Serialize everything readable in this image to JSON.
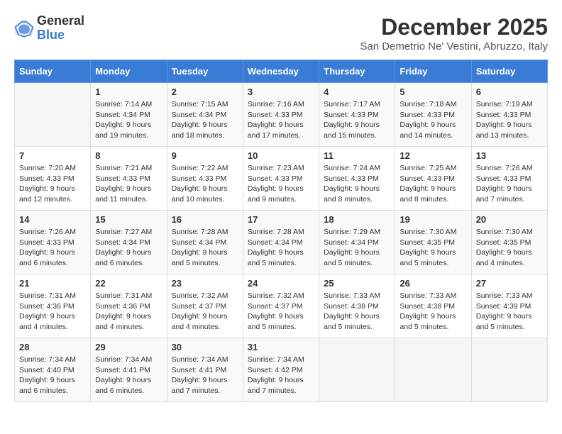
{
  "header": {
    "logo_general": "General",
    "logo_blue": "Blue",
    "month_year": "December 2025",
    "location": "San Demetrio Ne' Vestini, Abruzzo, Italy"
  },
  "days_of_week": [
    "Sunday",
    "Monday",
    "Tuesday",
    "Wednesday",
    "Thursday",
    "Friday",
    "Saturday"
  ],
  "weeks": [
    [
      {
        "day": "",
        "info": ""
      },
      {
        "day": "1",
        "info": "Sunrise: 7:14 AM\nSunset: 4:34 PM\nDaylight: 9 hours\nand 19 minutes."
      },
      {
        "day": "2",
        "info": "Sunrise: 7:15 AM\nSunset: 4:34 PM\nDaylight: 9 hours\nand 18 minutes."
      },
      {
        "day": "3",
        "info": "Sunrise: 7:16 AM\nSunset: 4:33 PM\nDaylight: 9 hours\nand 17 minutes."
      },
      {
        "day": "4",
        "info": "Sunrise: 7:17 AM\nSunset: 4:33 PM\nDaylight: 9 hours\nand 15 minutes."
      },
      {
        "day": "5",
        "info": "Sunrise: 7:18 AM\nSunset: 4:33 PM\nDaylight: 9 hours\nand 14 minutes."
      },
      {
        "day": "6",
        "info": "Sunrise: 7:19 AM\nSunset: 4:33 PM\nDaylight: 9 hours\nand 13 minutes."
      }
    ],
    [
      {
        "day": "7",
        "info": "Sunrise: 7:20 AM\nSunset: 4:33 PM\nDaylight: 9 hours\nand 12 minutes."
      },
      {
        "day": "8",
        "info": "Sunrise: 7:21 AM\nSunset: 4:33 PM\nDaylight: 9 hours\nand 11 minutes."
      },
      {
        "day": "9",
        "info": "Sunrise: 7:22 AM\nSunset: 4:33 PM\nDaylight: 9 hours\nand 10 minutes."
      },
      {
        "day": "10",
        "info": "Sunrise: 7:23 AM\nSunset: 4:33 PM\nDaylight: 9 hours\nand 9 minutes."
      },
      {
        "day": "11",
        "info": "Sunrise: 7:24 AM\nSunset: 4:33 PM\nDaylight: 9 hours\nand 8 minutes."
      },
      {
        "day": "12",
        "info": "Sunrise: 7:25 AM\nSunset: 4:33 PM\nDaylight: 9 hours\nand 8 minutes."
      },
      {
        "day": "13",
        "info": "Sunrise: 7:26 AM\nSunset: 4:33 PM\nDaylight: 9 hours\nand 7 minutes."
      }
    ],
    [
      {
        "day": "14",
        "info": "Sunrise: 7:26 AM\nSunset: 4:33 PM\nDaylight: 9 hours\nand 6 minutes."
      },
      {
        "day": "15",
        "info": "Sunrise: 7:27 AM\nSunset: 4:34 PM\nDaylight: 9 hours\nand 6 minutes."
      },
      {
        "day": "16",
        "info": "Sunrise: 7:28 AM\nSunset: 4:34 PM\nDaylight: 9 hours\nand 5 minutes."
      },
      {
        "day": "17",
        "info": "Sunrise: 7:28 AM\nSunset: 4:34 PM\nDaylight: 9 hours\nand 5 minutes."
      },
      {
        "day": "18",
        "info": "Sunrise: 7:29 AM\nSunset: 4:34 PM\nDaylight: 9 hours\nand 5 minutes."
      },
      {
        "day": "19",
        "info": "Sunrise: 7:30 AM\nSunset: 4:35 PM\nDaylight: 9 hours\nand 5 minutes."
      },
      {
        "day": "20",
        "info": "Sunrise: 7:30 AM\nSunset: 4:35 PM\nDaylight: 9 hours\nand 4 minutes."
      }
    ],
    [
      {
        "day": "21",
        "info": "Sunrise: 7:31 AM\nSunset: 4:36 PM\nDaylight: 9 hours\nand 4 minutes."
      },
      {
        "day": "22",
        "info": "Sunrise: 7:31 AM\nSunset: 4:36 PM\nDaylight: 9 hours\nand 4 minutes."
      },
      {
        "day": "23",
        "info": "Sunrise: 7:32 AM\nSunset: 4:37 PM\nDaylight: 9 hours\nand 4 minutes."
      },
      {
        "day": "24",
        "info": "Sunrise: 7:32 AM\nSunset: 4:37 PM\nDaylight: 9 hours\nand 5 minutes."
      },
      {
        "day": "25",
        "info": "Sunrise: 7:33 AM\nSunset: 4:38 PM\nDaylight: 9 hours\nand 5 minutes."
      },
      {
        "day": "26",
        "info": "Sunrise: 7:33 AM\nSunset: 4:38 PM\nDaylight: 9 hours\nand 5 minutes."
      },
      {
        "day": "27",
        "info": "Sunrise: 7:33 AM\nSunset: 4:39 PM\nDaylight: 9 hours\nand 5 minutes."
      }
    ],
    [
      {
        "day": "28",
        "info": "Sunrise: 7:34 AM\nSunset: 4:40 PM\nDaylight: 9 hours\nand 6 minutes."
      },
      {
        "day": "29",
        "info": "Sunrise: 7:34 AM\nSunset: 4:41 PM\nDaylight: 9 hours\nand 6 minutes."
      },
      {
        "day": "30",
        "info": "Sunrise: 7:34 AM\nSunset: 4:41 PM\nDaylight: 9 hours\nand 7 minutes."
      },
      {
        "day": "31",
        "info": "Sunrise: 7:34 AM\nSunset: 4:42 PM\nDaylight: 9 hours\nand 7 minutes."
      },
      {
        "day": "",
        "info": ""
      },
      {
        "day": "",
        "info": ""
      },
      {
        "day": "",
        "info": ""
      }
    ]
  ]
}
